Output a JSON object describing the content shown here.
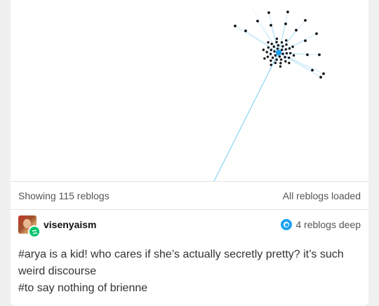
{
  "status": {
    "showing": "Showing 115 reblogs",
    "loaded": "All reblogs loaded"
  },
  "post": {
    "username": "visenyaism",
    "depth_label": "4 reblogs deep",
    "tags": [
      "#arya is a kid! who cares if she’s actually secretly pretty? it’s such weird discourse",
      "#to say nothing of brienne"
    ]
  },
  "colors": {
    "accent": "#1da1f2",
    "reblog_green": "#00c46a",
    "node": "#111111",
    "edge": "#8fd3f4"
  },
  "icons": {
    "reblog_badge": "reblog-icon",
    "depth": "target-icon"
  }
}
